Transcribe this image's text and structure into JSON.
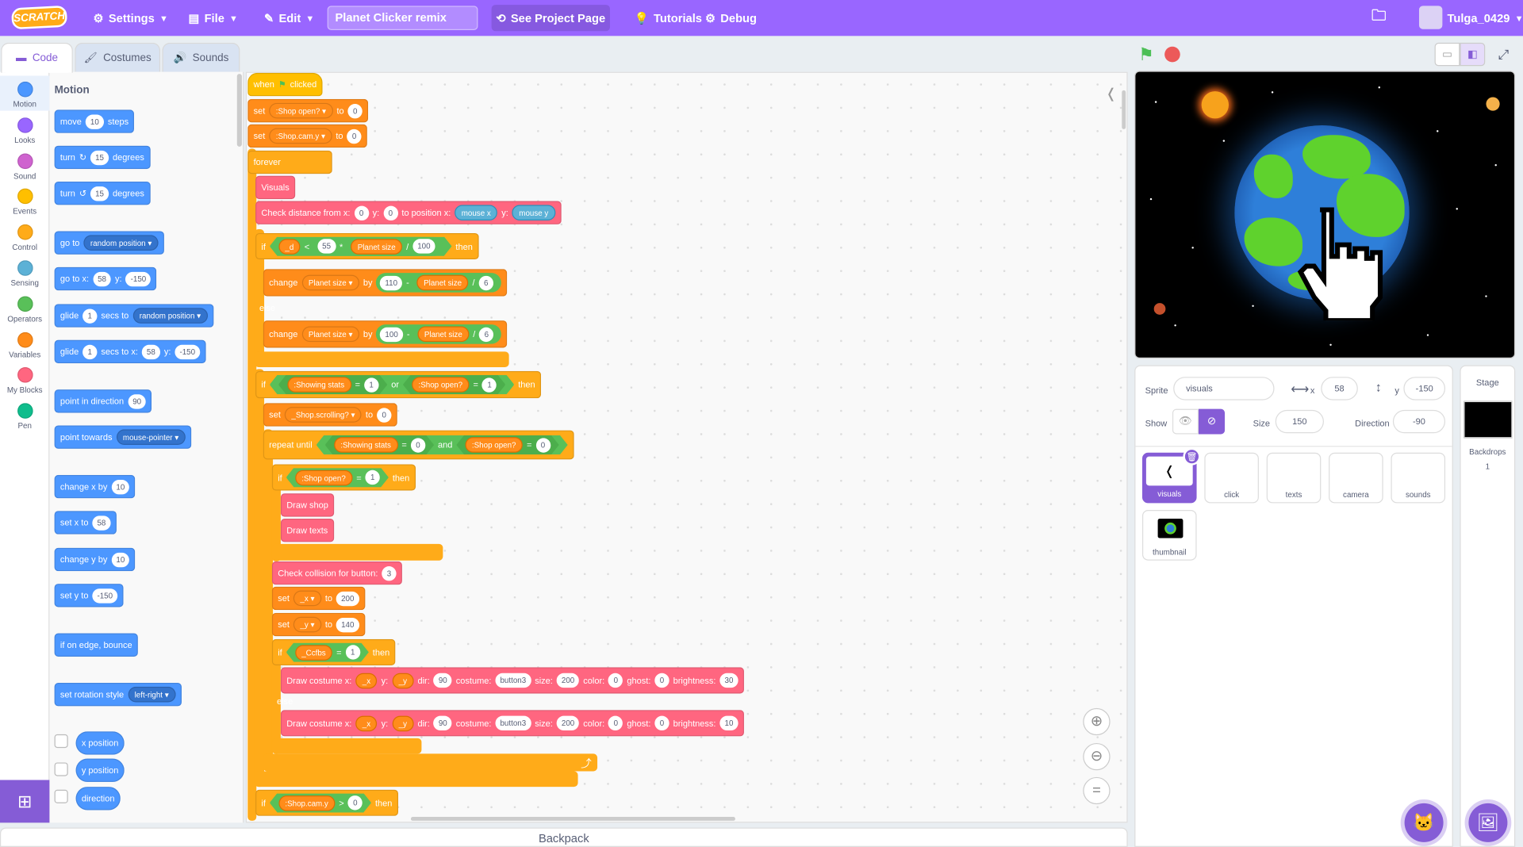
{
  "menubar": {
    "logo": "SCRATCH",
    "settings": "Settings",
    "file": "File",
    "edit": "Edit",
    "project_title": "Planet Clicker remix",
    "see_project": "See Project Page",
    "tutorials": "Tutorials",
    "debug": "Debug",
    "username": "Tulga_0429"
  },
  "tabs": {
    "code": "Code",
    "costumes": "Costumes",
    "sounds": "Sounds"
  },
  "categories": [
    {
      "label": "Motion",
      "color": "#4c97ff"
    },
    {
      "label": "Looks",
      "color": "#9966ff"
    },
    {
      "label": "Sound",
      "color": "#cf63cf"
    },
    {
      "label": "Events",
      "color": "#ffbf00"
    },
    {
      "label": "Control",
      "color": "#ffab19"
    },
    {
      "label": "Sensing",
      "color": "#5cb1d6"
    },
    {
      "label": "Operators",
      "color": "#59c059"
    },
    {
      "label": "Variables",
      "color": "#ff8c1a"
    },
    {
      "label": "My Blocks",
      "color": "#ff6680"
    },
    {
      "label": "Pen",
      "color": "#0fbd8c"
    }
  ],
  "palette": {
    "heading": "Motion",
    "move": "move",
    "move_steps": "10",
    "steps": "steps",
    "turn": "turn",
    "turn_deg": "15",
    "degrees": "degrees",
    "go_to": "go to",
    "random_position": "random position",
    "go_to_x": "go to x:",
    "x_val": "58",
    "y_label": "y:",
    "y_val": "-150",
    "glide": "glide",
    "glide_secs": "1",
    "secs_to": "secs to",
    "secs_to_x": "secs to x:",
    "point_dir": "point in direction",
    "dir_val": "90",
    "point_towards": "point towards",
    "mouse_pointer": "mouse-pointer",
    "change_x": "change x by",
    "change_val": "10",
    "set_x": "set x to",
    "change_y": "change y by",
    "set_y": "set y to",
    "bounce": "if on edge, bounce",
    "rotation": "set rotation style",
    "left_right": "left-right",
    "x_position": "x position",
    "y_position": "y position",
    "direction": "direction"
  },
  "script": {
    "when": "when",
    "clicked": "clicked",
    "set": "set",
    "to": "to",
    "zero": "0",
    "one": "1",
    "shop_open": ":Shop open?",
    "shop_cam_y": ":Shop.cam.y",
    "forever": "forever",
    "visuals": "Visuals",
    "check_distance": "Check distance from x:",
    "to_position_x": "to position x:",
    "y": "y:",
    "mouse_x": "mouse x",
    "mouse_y": "mouse y",
    "if": "if",
    "then": "then",
    "else": "else",
    "d": "_d",
    "lt": "<",
    "gt": ">",
    "eq": "=",
    "times": "*",
    "div": "/",
    "minus": "-",
    "n55": "55",
    "planet_size": "Planet size",
    "n100": "100",
    "change": "change",
    "by": "by",
    "n110": "110",
    "n6": "6",
    "showing_stats": ":Showing stats",
    "or": "or",
    "and": "and",
    "shop_scrolling": "_Shop.scrolling?",
    "repeat_until": "repeat until",
    "draw_shop": "Draw shop",
    "draw_texts": "Draw texts",
    "check_collision": "Check collision for button:",
    "n3": "3",
    "x": "_x",
    "yv": "_y",
    "n200": "200",
    "n140": "140",
    "ccfbs": "_Ccfbs",
    "draw_costume": "Draw costume x:",
    "dir": "dir:",
    "n90": "90",
    "costume": "costume:",
    "button3": "button3",
    "size": "size:",
    "color": "color:",
    "ghost": "ghost:",
    "brightness": "brightness:",
    "n30": "30",
    "n10": "10"
  },
  "backpack": "Backpack",
  "sprite_info": {
    "sprite_label": "Sprite",
    "sprite_name": "visuals",
    "x_label": "x",
    "x": "58",
    "y_label": "y",
    "y": "-150",
    "show_label": "Show",
    "size_label": "Size",
    "size": "150",
    "direction_label": "Direction",
    "direction": "-90"
  },
  "sprites": [
    "visuals",
    "click",
    "texts",
    "camera",
    "sounds",
    "thumbnail"
  ],
  "stage_pane": {
    "title": "Stage",
    "backdrops_label": "Backdrops",
    "backdrops_count": "1"
  }
}
